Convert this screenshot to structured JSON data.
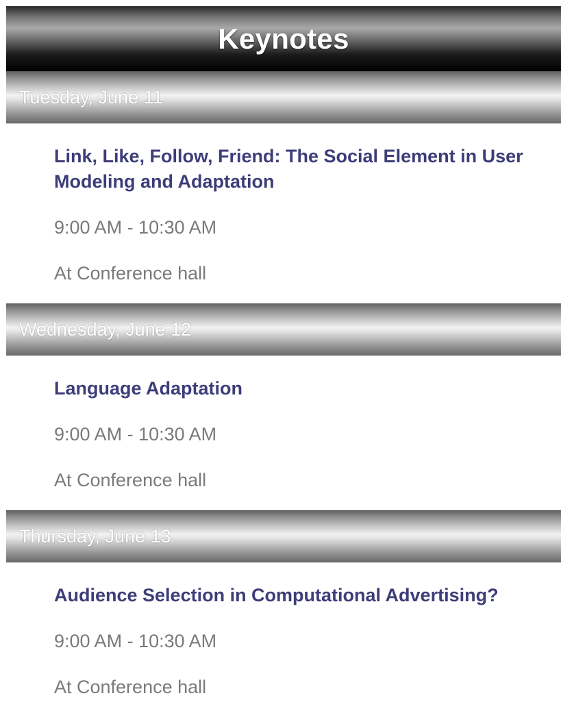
{
  "header": {
    "title": "Keynotes"
  },
  "days": [
    {
      "label": "Tuesday, June 11",
      "session": {
        "title": "Link, Like, Follow, Friend: The Social Element in User Modeling and Adaptation",
        "time": "9:00 AM - 10:30 AM",
        "location": "At Conference hall"
      }
    },
    {
      "label": "Wednesday, June 12",
      "session": {
        "title": "Language Adaptation",
        "time": "9:00 AM - 10:30 AM",
        "location": "At Conference hall"
      }
    },
    {
      "label": "Thursday, June 13",
      "session": {
        "title": "Audience Selection in Computational Advertising?",
        "time": "9:00 AM - 10:30 AM",
        "location": "At Conference hall"
      }
    }
  ]
}
